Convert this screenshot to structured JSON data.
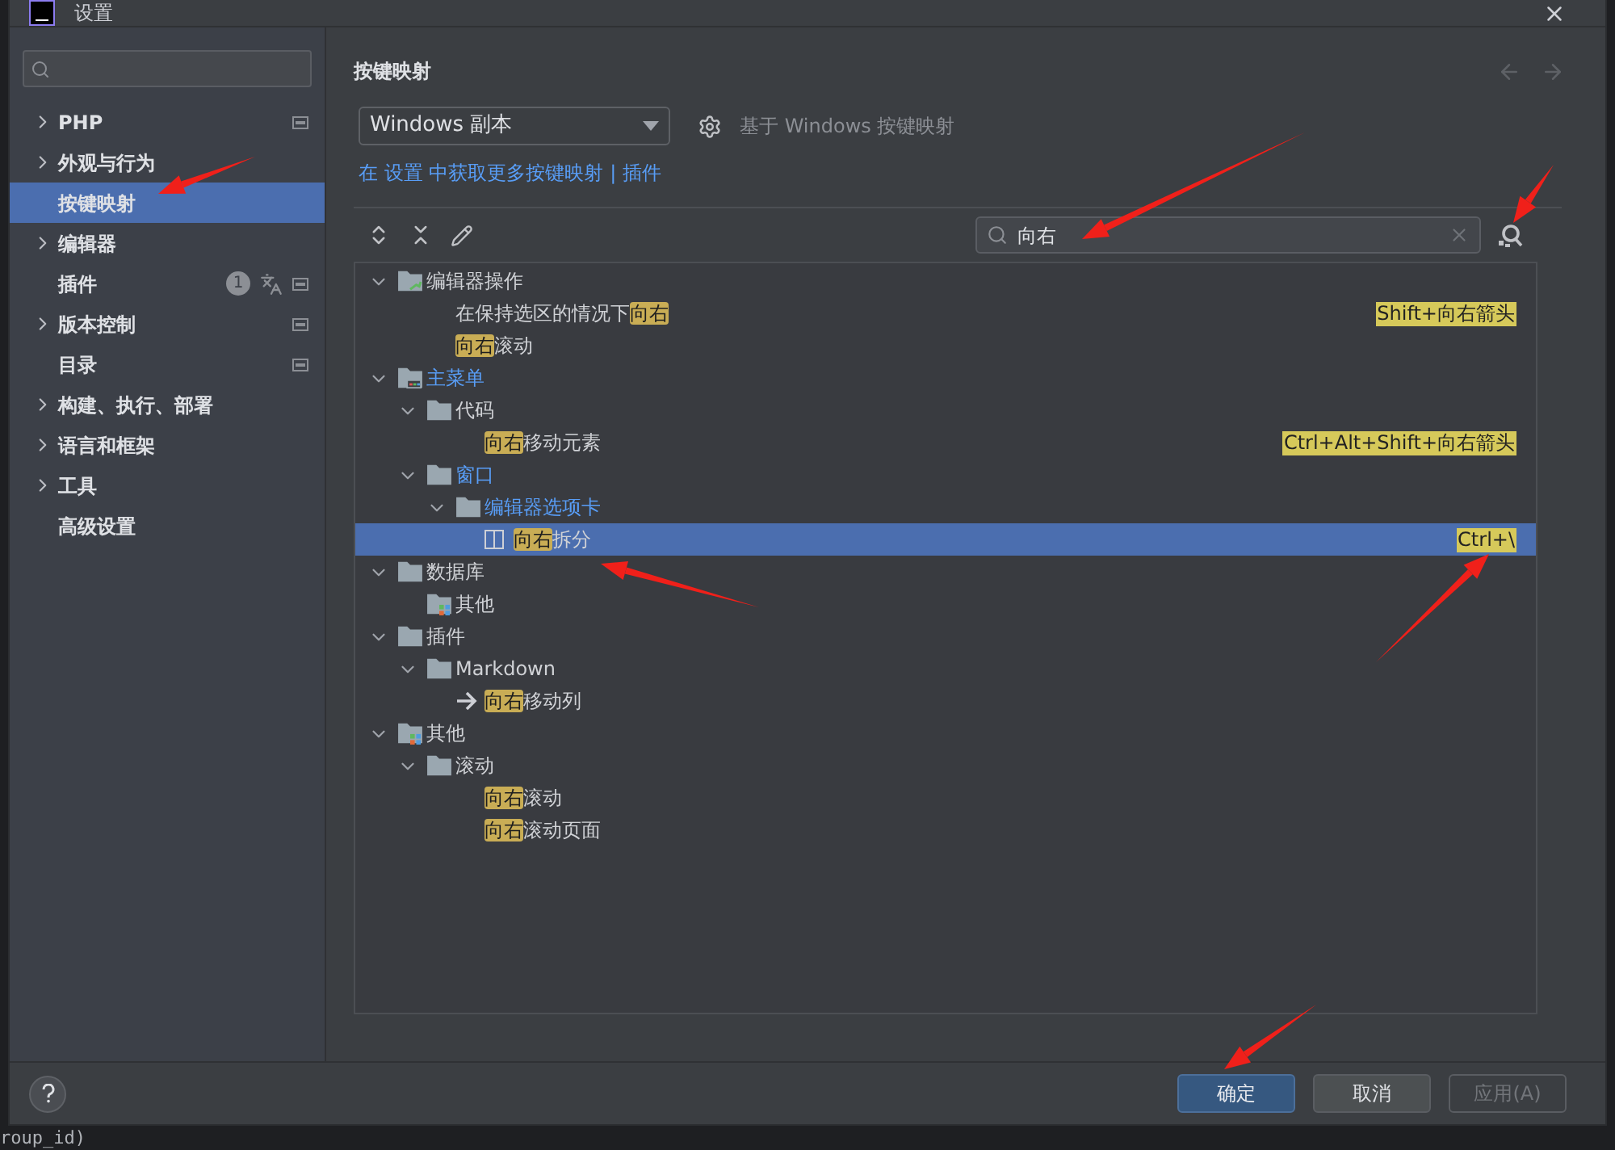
{
  "window": {
    "title": "设置"
  },
  "sidebar": {
    "items": [
      {
        "label": "PHP",
        "expandable": true,
        "selected": false,
        "project_scope": true
      },
      {
        "label": "外观与行为",
        "expandable": true,
        "selected": false,
        "project_scope": false
      },
      {
        "label": "按键映射",
        "expandable": false,
        "selected": true,
        "project_scope": false
      },
      {
        "label": "编辑器",
        "expandable": true,
        "selected": false,
        "project_scope": false
      },
      {
        "label": "插件",
        "expandable": false,
        "selected": false,
        "project_scope": true,
        "count": "1"
      },
      {
        "label": "版本控制",
        "expandable": true,
        "selected": false,
        "project_scope": true
      },
      {
        "label": "目录",
        "expandable": false,
        "selected": false,
        "project_scope": true
      },
      {
        "label": "构建、执行、部署",
        "expandable": true,
        "selected": false,
        "project_scope": false
      },
      {
        "label": "语言和框架",
        "expandable": true,
        "selected": false,
        "project_scope": false
      },
      {
        "label": "工具",
        "expandable": true,
        "selected": false,
        "project_scope": false
      },
      {
        "label": "高级设置",
        "expandable": false,
        "selected": false,
        "project_scope": false
      }
    ]
  },
  "content": {
    "title": "按键映射",
    "nav": {
      "back_disabled": true,
      "forward_disabled": true
    },
    "keymap": {
      "value": "Windows 副本",
      "based_on": "基于 Windows 按键映射"
    },
    "link_line": {
      "parts": [
        "在 设置 中获取更多按键映射",
        "|",
        "插件"
      ]
    },
    "search": {
      "value": "向右"
    },
    "tree": [
      {
        "kind": "actions-folder",
        "expanded": true,
        "modified": false,
        "selected": false,
        "parts": [
          {
            "text": "编辑器操作",
            "match": false
          }
        ],
        "children": [
          {
            "kind": "action",
            "modified": false,
            "selected": false,
            "parts": [
              {
                "text": "在保持选区的情况下",
                "match": false
              },
              {
                "text": "向右",
                "match": true
              }
            ],
            "shortcut": "Shift+向右箭头"
          },
          {
            "kind": "action",
            "modified": false,
            "selected": false,
            "parts": [
              {
                "text": "向右",
                "match": true
              },
              {
                "text": "滚动",
                "match": false
              }
            ]
          }
        ]
      },
      {
        "kind": "menu-folder",
        "expanded": true,
        "modified": true,
        "selected": false,
        "parts": [
          {
            "text": "主菜单",
            "match": false
          }
        ],
        "children": [
          {
            "kind": "folder",
            "expanded": true,
            "modified": false,
            "selected": false,
            "parts": [
              {
                "text": "代码",
                "match": false
              }
            ],
            "children": [
              {
                "kind": "action",
                "modified": false,
                "selected": false,
                "parts": [
                  {
                    "text": "向右",
                    "match": true
                  },
                  {
                    "text": "移动元素",
                    "match": false
                  }
                ],
                "shortcut": "Ctrl+Alt+Shift+向右箭头"
              }
            ]
          },
          {
            "kind": "folder",
            "expanded": true,
            "modified": true,
            "selected": false,
            "parts": [
              {
                "text": "窗口",
                "match": false
              }
            ],
            "children": [
              {
                "kind": "folder",
                "expanded": true,
                "modified": true,
                "selected": false,
                "parts": [
                  {
                    "text": "编辑器选项卡",
                    "match": false
                  }
                ],
                "children": [
                  {
                    "kind": "split-action",
                    "modified": false,
                    "selected": true,
                    "parts": [
                      {
                        "text": "向右",
                        "match": true
                      },
                      {
                        "text": "拆分",
                        "match": false
                      }
                    ],
                    "shortcut": "Ctrl+\\"
                  }
                ]
              }
            ]
          }
        ]
      },
      {
        "kind": "folder",
        "expanded": true,
        "modified": false,
        "selected": false,
        "parts": [
          {
            "text": "数据库",
            "match": false
          }
        ],
        "children": [
          {
            "kind": "plugins-action",
            "modified": false,
            "selected": false,
            "parts": [
              {
                "text": "其他",
                "match": false
              }
            ]
          }
        ]
      },
      {
        "kind": "folder",
        "expanded": true,
        "modified": false,
        "selected": false,
        "parts": [
          {
            "text": "插件",
            "match": false
          }
        ],
        "children": [
          {
            "kind": "folder",
            "expanded": true,
            "modified": false,
            "selected": false,
            "parts": [
              {
                "text": "Markdown",
                "match": false
              }
            ],
            "children": [
              {
                "kind": "arrow-action",
                "modified": false,
                "selected": false,
                "parts": [
                  {
                    "text": "向右",
                    "match": true
                  },
                  {
                    "text": "移动列",
                    "match": false
                  }
                ]
              }
            ]
          }
        ]
      },
      {
        "kind": "plugins-folder",
        "expanded": true,
        "modified": false,
        "selected": false,
        "parts": [
          {
            "text": "其他",
            "match": false
          }
        ],
        "children": [
          {
            "kind": "folder",
            "expanded": true,
            "modified": false,
            "selected": false,
            "parts": [
              {
                "text": "滚动",
                "match": false
              }
            ],
            "children": [
              {
                "kind": "action",
                "modified": false,
                "selected": false,
                "parts": [
                  {
                    "text": "向右",
                    "match": true
                  },
                  {
                    "text": "滚动",
                    "match": false
                  }
                ]
              },
              {
                "kind": "action",
                "modified": false,
                "selected": false,
                "parts": [
                  {
                    "text": "向右",
                    "match": true
                  },
                  {
                    "text": "滚动页面",
                    "match": false
                  }
                ]
              }
            ]
          }
        ]
      }
    ]
  },
  "buttons": [
    {
      "label": "确定",
      "kind": "primary",
      "disabled": false
    },
    {
      "label": "取消",
      "kind": "normal",
      "disabled": false
    },
    {
      "label": "应用(A)",
      "kind": "normal",
      "disabled": true
    }
  ],
  "background_code": "roup_id)"
}
